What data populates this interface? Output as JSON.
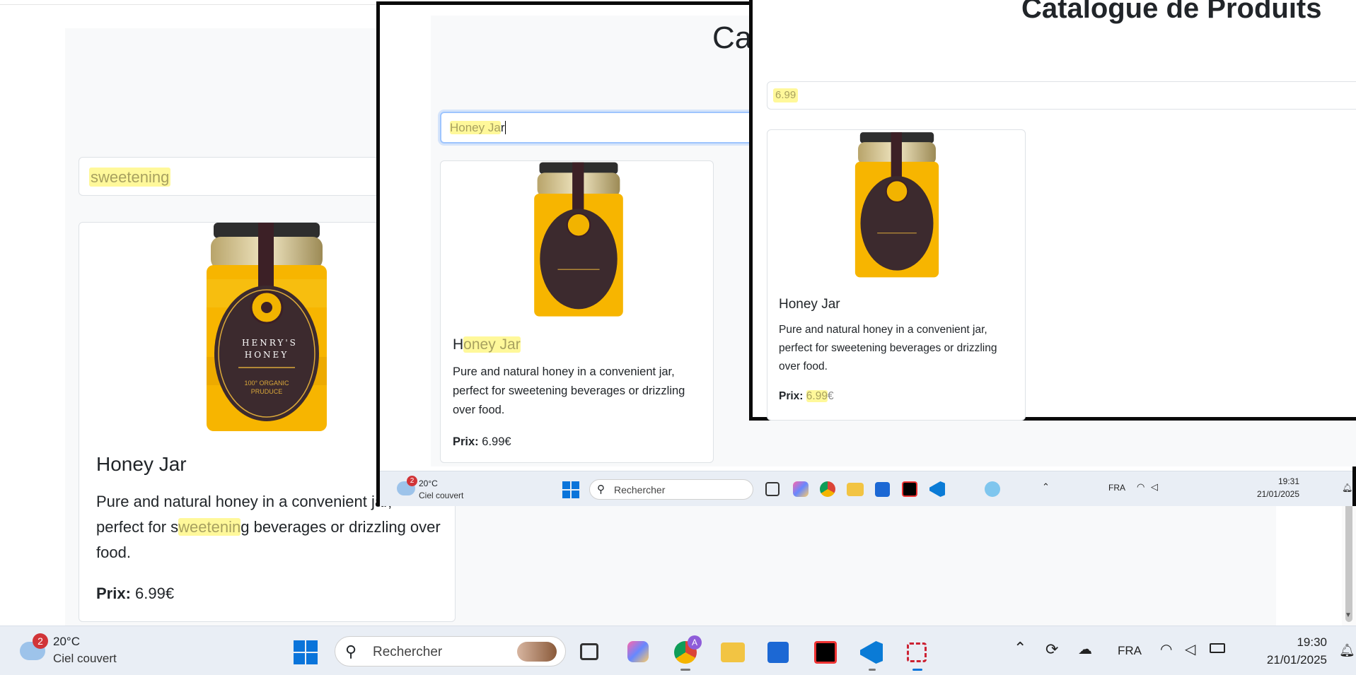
{
  "background_window": {
    "search_value": "sweetening",
    "card": {
      "title": "Honey Jar",
      "description_parts": [
        "Pure and natural honey in a convenient jar, perfect for s",
        "weetenin",
        "g beverages or drizzling over food."
      ],
      "price_label": "Prix:",
      "price_value": "6.99€"
    }
  },
  "middle_window": {
    "heading_fragment": "Cat",
    "search_value": "Honey Jar",
    "search_highlight": "Honey Ja",
    "search_rest": "r",
    "card": {
      "title_first": "H",
      "title_rest": "oney Jar",
      "description": "Pure and natural honey in a convenient jar, perfect for sweetening beverages or drizzling over food.",
      "price_label": "Prix:",
      "price_value": "6.99€"
    },
    "taskbar": {
      "weather_temp": "20°C",
      "weather_desc": "Ciel couvert",
      "weather_badge": "2",
      "search_placeholder": "Rechercher",
      "lang": "FRA",
      "time": "19:31",
      "date": "21/01/2025"
    }
  },
  "front_window": {
    "heading": "Catalogue de Produits",
    "search_value": "6.99",
    "card": {
      "title": "Honey Jar",
      "description": "Pure and natural honey in a convenient jar, perfect for sweetening beverages or drizzling over food.",
      "price_label": "Prix:",
      "price_value_hl": "6.99",
      "price_currency": "€"
    }
  },
  "jar_label": {
    "brand_line1": "HENRY'S",
    "brand_line2": "HONEY",
    "sub1": "100° ORGANIC",
    "sub2": "PRUDUCE"
  },
  "taskbar": {
    "weather_temp": "20°C",
    "weather_desc": "Ciel couvert",
    "weather_badge": "2",
    "search_placeholder": "Rechercher",
    "lang": "FRA",
    "time": "19:30",
    "date": "21/01/2025",
    "chrome_badge": "A"
  },
  "colors": {
    "highlight": "#fff57a",
    "taskbar": "#e9eef5",
    "honey": "#f6b800",
    "label": "#3c2a2e",
    "accent_blue": "#0078d4"
  }
}
